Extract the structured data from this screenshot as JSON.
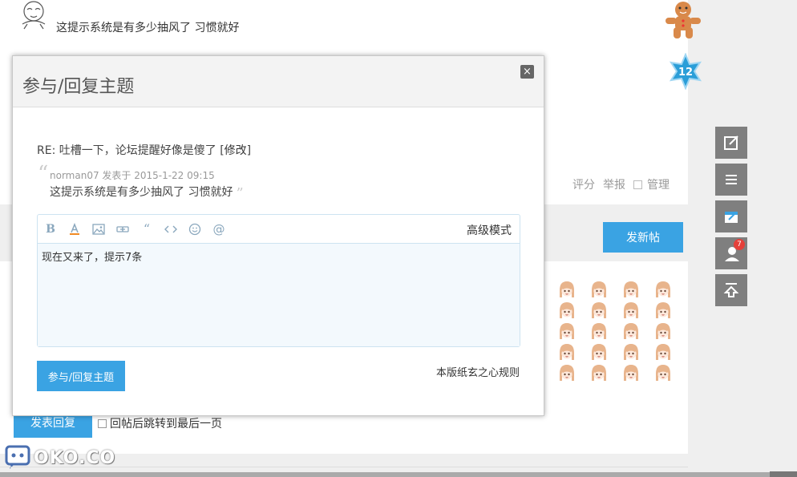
{
  "background": {
    "top_quote": "这提示系统是有多少抽风了  习惯就好",
    "badge_level": "12",
    "actions": {
      "rate": "评分",
      "report": "举报",
      "manage": "管理"
    },
    "new_post_label": "发新帖",
    "reply_button_label": "发表回复",
    "jump_last_label": "回帖后跳转到最后一页",
    "watermark": "OKO.CO"
  },
  "side_toolbar": {
    "notification_count": "7"
  },
  "modal": {
    "title": "参与/回复主题",
    "close_label": "×",
    "re_prefix": "RE: 吐槽一下，论坛提醒好像是傻了 [",
    "edit_label": "修改",
    "re_suffix": "]",
    "quote_meta": "norman07 发表于 2015-1-22 09:15",
    "quote_text": "这提示系统是有多少抽风了  习惯就好",
    "editor": {
      "advanced_mode": "高级模式",
      "content": "现在又来了，提示7条"
    },
    "submit_label": "参与/回复主题",
    "rules_link": "本版纸玄之心规则"
  },
  "colors": {
    "accent": "#3aa3e3",
    "side_tool": "#7f7f7f",
    "editor_bg": "#f3f9fd",
    "badge": "#e4403a"
  }
}
